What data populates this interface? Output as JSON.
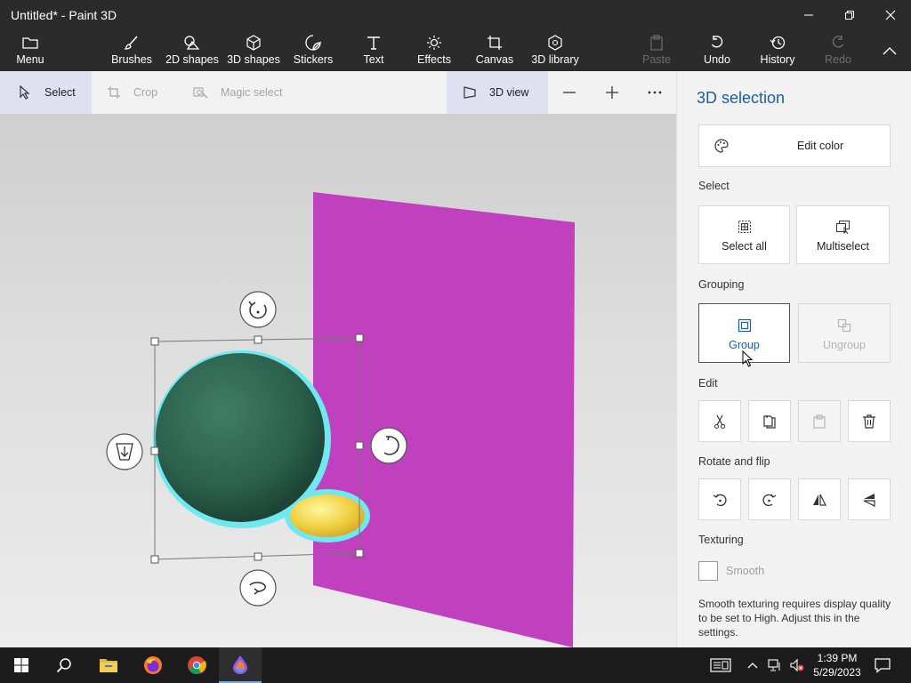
{
  "window": {
    "title": "Untitled* - Paint 3D",
    "controls": [
      "minimize-icon",
      "restore-icon",
      "close-icon"
    ]
  },
  "ribbon": {
    "menu": "Menu",
    "items": [
      {
        "label": "Brushes",
        "icon": "brush-icon"
      },
      {
        "label": "2D shapes",
        "icon": "2d-shapes-icon"
      },
      {
        "label": "3D shapes",
        "icon": "cube-icon"
      },
      {
        "label": "Stickers",
        "icon": "sticker-icon"
      },
      {
        "label": "Text",
        "icon": "text-icon"
      },
      {
        "label": "Effects",
        "icon": "sun-icon"
      },
      {
        "label": "Canvas",
        "icon": "canvas-icon"
      },
      {
        "label": "3D library",
        "icon": "library-icon"
      }
    ],
    "paste": "Paste",
    "undo": "Undo",
    "history": "History",
    "redo": "Redo"
  },
  "toolbar": {
    "select": "Select",
    "crop": "Crop",
    "magic_select": "Magic select",
    "view_3d": "3D view",
    "zoom_out": "—",
    "zoom_in": "+",
    "more": "···"
  },
  "panel": {
    "title": "3D selection",
    "edit_color": "Edit color",
    "select_label": "Select",
    "select_all": "Select all",
    "multiselect": "Multiselect",
    "grouping_label": "Grouping",
    "group": "Group",
    "ungroup": "Ungroup",
    "edit_label": "Edit",
    "rotate_label": "Rotate and flip",
    "texturing_label": "Texturing",
    "smooth": "Smooth",
    "smooth_checked": false,
    "note": "Smooth texturing requires display quality to be set to High. Adjust this in the settings."
  },
  "taskbar": {
    "time": "1:39 PM",
    "date": "5/29/2023"
  },
  "colors": {
    "accent": "#1a5fa6",
    "magenta_plane": "#c040c0",
    "sphere": "#2f6b55",
    "selection_glow": "#6fe8f0",
    "yellow_object": "#f0d040"
  }
}
